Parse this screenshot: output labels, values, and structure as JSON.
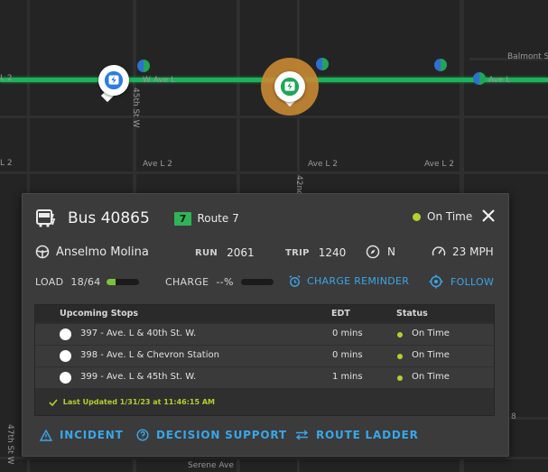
{
  "map": {
    "street_labels": {
      "w_ave_l_left": "W Ave L",
      "w_ave_l_mid": "W Ave L",
      "balmont": "Balmont S",
      "ave_l_right": "Ave L",
      "ave_l2_a": "Ave L 2",
      "ave_l2_b": "Ave L 2",
      "ave_l2_c": "Ave L 2",
      "l2_left": "L 2",
      "street_45th_top": "45th St W",
      "street_42nd": "42nd",
      "street_47th": "47th St W",
      "serene": "Serene Ave",
      "right_8": "8"
    },
    "route_color": "#1fb15a"
  },
  "panel": {
    "bus_title": "Bus 40865",
    "route_number": "7",
    "route_name": "Route 7",
    "status": "On Time",
    "driver": "Anselmo Molina",
    "run_label": "RUN",
    "run_value": "2061",
    "trip_label": "TRIP",
    "trip_value": "1240",
    "direction": "N",
    "speed": "23 MPH",
    "load_label": "LOAD",
    "load_value": "18/64",
    "load_fraction": 0.28,
    "charge_label": "CHARGE",
    "charge_value": "--%",
    "charge_fraction": 0,
    "charge_reminder": "CHARGE REMINDER",
    "follow": "FOLLOW",
    "stops_table": {
      "headers": {
        "stops": "Upcoming Stops",
        "edt": "EDT",
        "status": "Status"
      },
      "rows": [
        {
          "stop": "397 - Ave. L & 40th St. W.",
          "edt": "0 mins",
          "status": "On Time"
        },
        {
          "stop": "398 - Ave. L & Chevron Station",
          "edt": "0 mins",
          "status": "On Time"
        },
        {
          "stop": "399 - Ave. L & 45th St. W.",
          "edt": "1 mins",
          "status": "On Time"
        }
      ],
      "last_updated": "Last Updated 1/31/23 at 11:46:15 AM"
    },
    "actions": {
      "incident": "INCIDENT",
      "decision_support": "DECISION SUPPORT",
      "route_ladder": "ROUTE LADDER"
    }
  },
  "colors": {
    "accent_blue": "#3aa6e8",
    "status_green": "#b7cf2e",
    "route_badge": "#2fb457"
  }
}
